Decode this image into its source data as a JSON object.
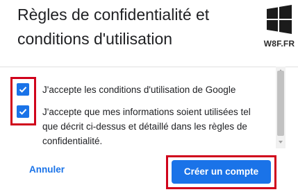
{
  "dialog": {
    "title": "Règles de confidentialité et conditions d'utilisation"
  },
  "logo": {
    "text": "W8F.FR",
    "icon": "windows-logo-icon"
  },
  "consents": [
    {
      "label": "J'accepte les conditions d'utilisation de Google",
      "checked": true
    },
    {
      "label": "J'accepte que mes informations soient utilisées tel que décrit ci-dessus et détaillé dans les règles de confidentialité.",
      "checked": true
    }
  ],
  "actions": {
    "cancel_label": "Annuler",
    "submit_label": "Créer un compte"
  },
  "colors": {
    "accent": "#1a73e8",
    "highlight": "#d0021b"
  }
}
